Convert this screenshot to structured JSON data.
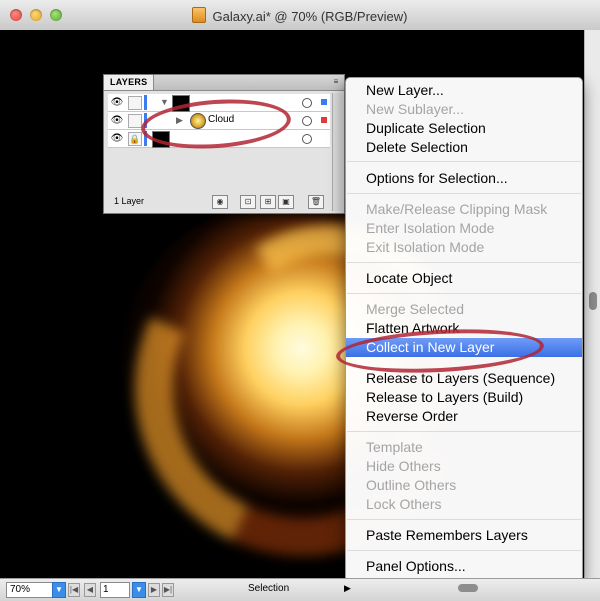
{
  "window": {
    "title": "Galaxy.ai* @ 70% (RGB/Preview)"
  },
  "status_bar": {
    "zoom": "70%",
    "page": "1",
    "current_tool": "Selection"
  },
  "layers_panel": {
    "tab_label": "LAYERS",
    "menu_glyph": "≡",
    "rows": [
      {
        "name": "",
        "indent": false
      },
      {
        "name": "Cloud",
        "indent": true
      },
      {
        "name": "",
        "indent": false
      }
    ],
    "footer_count": "1 Layer"
  },
  "context_menu": {
    "items": [
      {
        "label": "New Layer...",
        "enabled": true
      },
      {
        "label": "New Sublayer...",
        "enabled": false
      },
      {
        "label": "Duplicate Selection",
        "enabled": true
      },
      {
        "label": "Delete Selection",
        "enabled": true
      },
      {
        "label": "Options for Selection...",
        "enabled": true
      },
      {
        "label": "Make/Release Clipping Mask",
        "enabled": false
      },
      {
        "label": "Enter Isolation Mode",
        "enabled": false
      },
      {
        "label": "Exit Isolation Mode",
        "enabled": false
      },
      {
        "label": "Locate Object",
        "enabled": true
      },
      {
        "label": "Merge Selected",
        "enabled": false
      },
      {
        "label": "Flatten Artwork",
        "enabled": true
      },
      {
        "label": "Collect in New Layer",
        "enabled": true,
        "highlighted": true
      },
      {
        "label": "Release to Layers (Sequence)",
        "enabled": true
      },
      {
        "label": "Release to Layers (Build)",
        "enabled": true
      },
      {
        "label": "Reverse Order",
        "enabled": true
      },
      {
        "label": "Template",
        "enabled": false
      },
      {
        "label": "Hide Others",
        "enabled": false
      },
      {
        "label": "Outline Others",
        "enabled": false
      },
      {
        "label": "Lock Others",
        "enabled": false
      },
      {
        "label": "Paste Remembers Layers",
        "enabled": true
      },
      {
        "label": "Panel Options...",
        "enabled": true
      }
    ]
  },
  "colors": {
    "highlight": "#3b70e6",
    "annotation": "#b02634",
    "layer_blue": "#3d7bf0",
    "layer_red": "#e03a3a"
  },
  "icons": {
    "visibility": "eye-icon",
    "lock": "lock-icon",
    "expand": "disclosure-triangle-icon",
    "panel_menu": "panel-menu-icon"
  }
}
